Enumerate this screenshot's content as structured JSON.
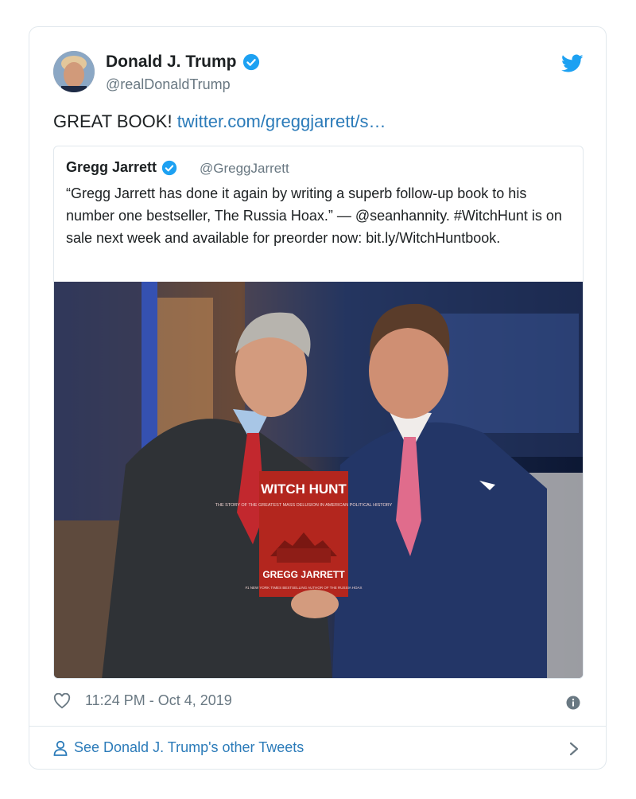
{
  "tweet": {
    "author_name": "Donald J. Trump",
    "author_handle": "@realDonaldTrump",
    "text": "GREAT BOOK!",
    "link_text": "twitter.com/greggjarrett/s…",
    "timestamp": "11:24 PM - Oct 4, 2019",
    "see_more": "See Donald J. Trump's other Tweets"
  },
  "quoted": {
    "author_name": "Gregg Jarrett",
    "author_handle": "@GreggJarrett",
    "text": "“Gregg Jarrett has done it again by writing a superb follow-up book to his number one bestseller, The Russia Hoax.” — @seanhannity. #WitchHunt is on sale next week and available for preorder now: bit.ly/WitchHuntbook.",
    "photo": {
      "book_title": "WITCH HUNT",
      "book_subtitle": "THE STORY OF THE GREATEST MASS DELUSION IN AMERICAN POLITICAL HISTORY",
      "book_author": "GREGG JARRETT",
      "book_tagline": "#1 NEW YORK TIMES BESTSELLING AUTHOR OF THE RUSSIA HOAX"
    }
  },
  "colors": {
    "link": "#2b7bb9",
    "verified": "#1da1f2",
    "twitter_bird": "#1da1f2",
    "muted_text": "#697882",
    "border": "#e1e8ed",
    "book_red": "#b3261e"
  },
  "icons": [
    "verified-badge-icon",
    "twitter-bird-icon",
    "heart-icon",
    "info-icon",
    "user-icon",
    "chevron-right-icon"
  ]
}
